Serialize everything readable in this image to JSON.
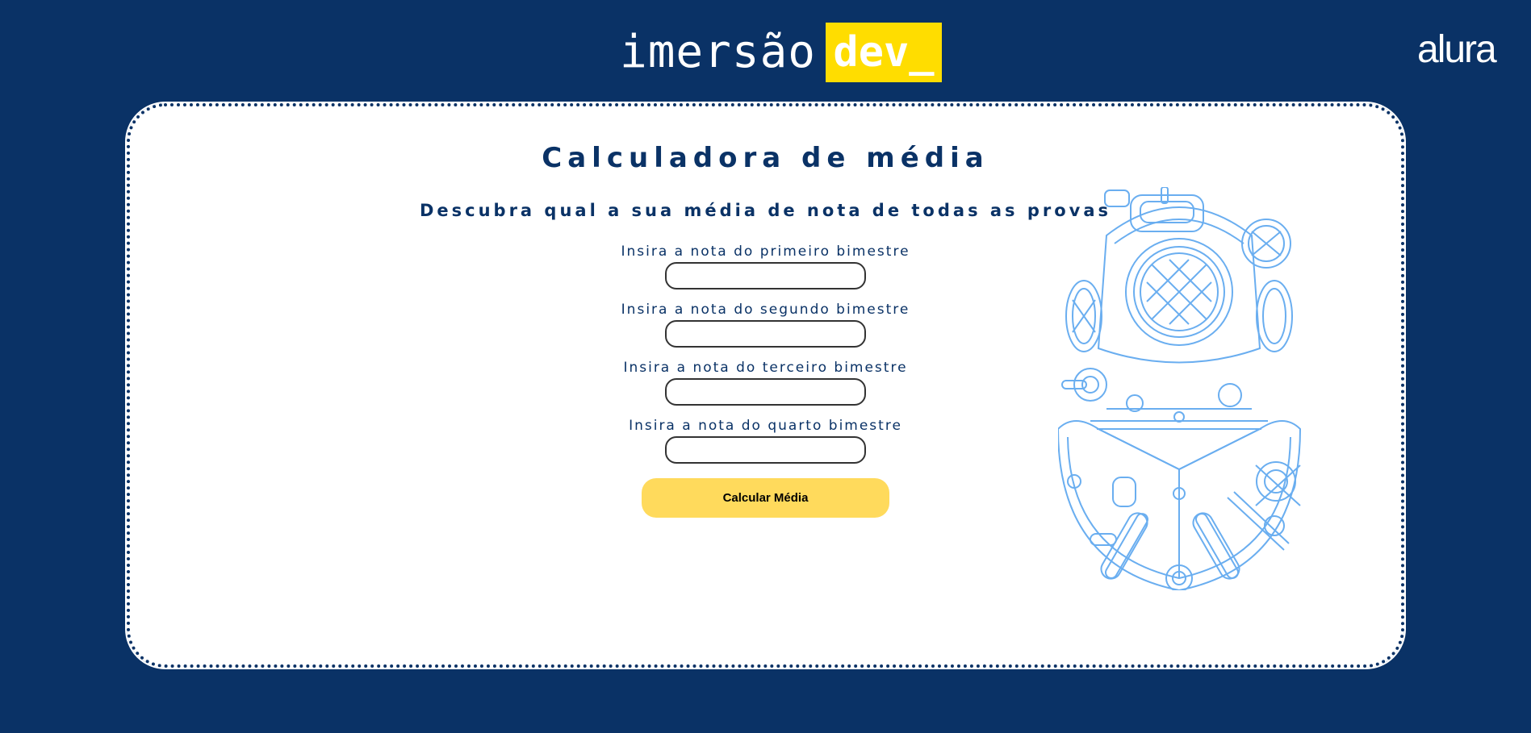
{
  "header": {
    "brand_word": "imersão",
    "brand_highlight": "dev_",
    "partner_logo": "alura"
  },
  "card": {
    "title": "Calculadora de média",
    "subtitle": "Descubra qual a sua média de nota de todas as provas",
    "fields": [
      {
        "label": "Insira a nota do primeiro bimestre",
        "value": ""
      },
      {
        "label": "Insira a nota do segundo bimestre",
        "value": ""
      },
      {
        "label": "Insira a nota do terceiro bimestre",
        "value": ""
      },
      {
        "label": "Insira a nota do quarto bimestre",
        "value": ""
      }
    ],
    "button_label": "Calcular Média"
  },
  "colors": {
    "background": "#0a3266",
    "brand_highlight": "#ffdd00",
    "button": "#ffda5c",
    "illustration_stroke": "#6aaef0"
  },
  "icons": {
    "illustration": "diving-helmet-illustration"
  }
}
